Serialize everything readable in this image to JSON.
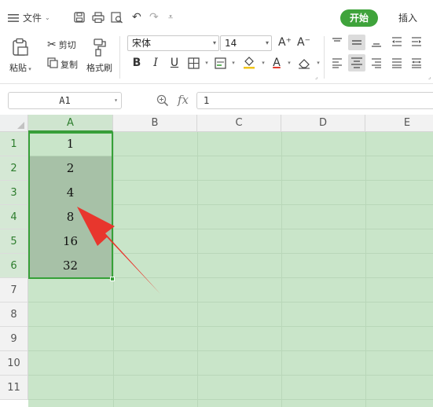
{
  "menubar": {
    "file_label": "文件",
    "tab_home": "开始",
    "tab_insert": "插入"
  },
  "ribbon": {
    "paste_label": "粘贴",
    "cut_label": "剪切",
    "copy_label": "复制",
    "format_painter_label": "格式刷",
    "font_name": "宋体",
    "font_size": "14",
    "bold": "B",
    "italic": "I",
    "underline": "U",
    "font_color_letter": "A",
    "grow_font": "A⁺",
    "shrink_font": "A⁻"
  },
  "formula_bar": {
    "name_box": "A1",
    "fx_label": "fx",
    "value": "1"
  },
  "sheet": {
    "columns": [
      "A",
      "B",
      "C",
      "D",
      "E"
    ],
    "rows": [
      "1",
      "2",
      "3",
      "4",
      "5",
      "6",
      "7",
      "8",
      "9",
      "10",
      "11"
    ],
    "column_a_values": [
      "1",
      "2",
      "4",
      "8",
      "16",
      "32"
    ]
  },
  "colors": {
    "accent": "#3fa33b",
    "selection_border": "#36a138",
    "grid_fill": "#c9e5c9",
    "arrow": "#e8362d"
  }
}
